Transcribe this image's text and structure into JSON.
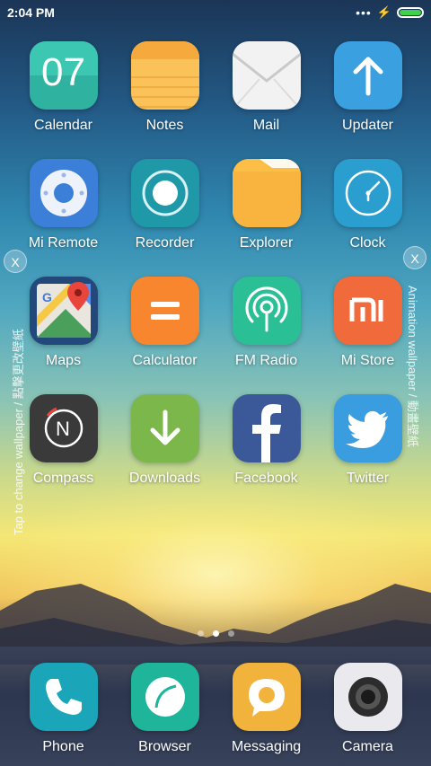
{
  "status_bar": {
    "time": "2:04 PM",
    "battery_level": 1.0,
    "battery_color": "#3fd14a"
  },
  "apps": [
    [
      {
        "label": "Calendar",
        "icon": "calendar-icon",
        "day": "07",
        "color": "#2fb3a0"
      },
      {
        "label": "Notes",
        "icon": "notes-icon",
        "color": "#fbc25a"
      },
      {
        "label": "Mail",
        "icon": "mail-icon",
        "color": "#f2f2f2"
      },
      {
        "label": "Updater",
        "icon": "up-arrow-icon",
        "color": "#3aa0e0"
      }
    ],
    [
      {
        "label": "Mi Remote",
        "icon": "remote-icon",
        "color": "#3b7fd8"
      },
      {
        "label": "Recorder",
        "icon": "record-icon",
        "color": "#1f98a8"
      },
      {
        "label": "Explorer",
        "icon": "folder-icon",
        "color": "#f7a62f"
      },
      {
        "label": "Clock",
        "icon": "clock-icon",
        "color": "#2a9fcf"
      }
    ],
    [
      {
        "label": "Maps",
        "icon": "maps-icon",
        "color": "#23487a"
      },
      {
        "label": "Calculator",
        "icon": "calculator-icon",
        "color": "#f7862e"
      },
      {
        "label": "FM Radio",
        "icon": "radio-icon",
        "color": "#2bbf96"
      },
      {
        "label": "Mi Store",
        "icon": "mi-store-icon",
        "color": "#f06a3c"
      }
    ],
    [
      {
        "label": "Compass",
        "icon": "compass-icon",
        "color": "#3a3a3a"
      },
      {
        "label": "Downloads",
        "icon": "download-icon",
        "color": "#7bb74a"
      },
      {
        "label": "Facebook",
        "icon": "facebook-icon",
        "color": "#3b5998"
      },
      {
        "label": "Twitter",
        "icon": "twitter-icon",
        "color": "#3a9de0"
      }
    ]
  ],
  "dock": [
    {
      "label": "Phone",
      "icon": "phone-icon",
      "color": "#1aa6b8"
    },
    {
      "label": "Browser",
      "icon": "browser-icon",
      "color": "#1fb59a"
    },
    {
      "label": "Messaging",
      "icon": "message-icon",
      "color": "#f2b33c"
    },
    {
      "label": "Camera",
      "icon": "camera-icon",
      "color": "#e9e9ee"
    }
  ],
  "side_panels": {
    "left": {
      "close": "X",
      "text": "Tap to change wallpaper / 點擊更改壁紙"
    },
    "right": {
      "close": "X",
      "text": "Animation wallpaper / 動畫壁紙"
    }
  },
  "pager": {
    "pages": 3,
    "active": 1
  }
}
